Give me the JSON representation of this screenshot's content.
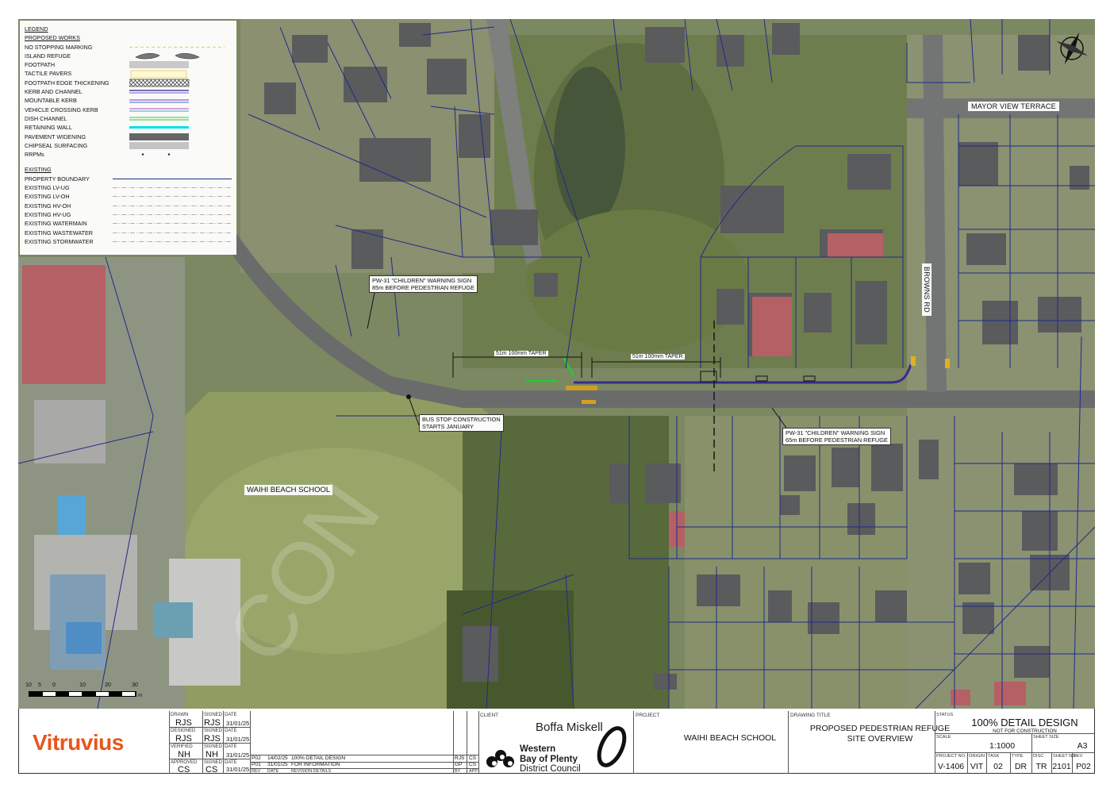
{
  "legend": {
    "heading": "LEGEND",
    "proposed_heading": "PROPOSED WORKS",
    "proposed": [
      {
        "label": "NO STOPPING MARKING",
        "symbol": "dash-yellow"
      },
      {
        "label": "ISLAND REFUGE",
        "symbol": "island"
      },
      {
        "label": "FOOTPATH",
        "symbol": "grey-fill"
      },
      {
        "label": "TACTILE PAVERS",
        "symbol": "tactile"
      },
      {
        "label": "FOOTPATH EDGE THICKENING",
        "symbol": "hatch"
      },
      {
        "label": "KERB AND CHANNEL",
        "symbol": "kerb"
      },
      {
        "label": "MOUNTABLE KERB",
        "symbol": "mountable"
      },
      {
        "label": "VEHICLE CROSSING KERB",
        "symbol": "vehicle"
      },
      {
        "label": "DISH CHANNEL",
        "symbol": "dish"
      },
      {
        "label": "RETAINING WALL",
        "symbol": "cyan"
      },
      {
        "label": "PAVEMENT WIDENING",
        "symbol": "dark-fill"
      },
      {
        "label": "CHIPSEAL SURFACING",
        "symbol": "light-fill"
      },
      {
        "label": "RRPMs",
        "symbol": "dots"
      }
    ],
    "existing_heading": "EXISTING",
    "existing": [
      {
        "label": "PROPERTY BOUNDARY",
        "symbol": "boundary"
      },
      {
        "label": "EXISTING LV-UG",
        "symbol": "service"
      },
      {
        "label": "EXISTING LV-OH",
        "symbol": "service"
      },
      {
        "label": "EXISTING HV-OH",
        "symbol": "service"
      },
      {
        "label": "EXISTING HV-UG",
        "symbol": "service"
      },
      {
        "label": "EXISTING WATERMAIN",
        "symbol": "service"
      },
      {
        "label": "EXISTING WASTEWATER",
        "symbol": "service"
      },
      {
        "label": "EXISTING STORMWATER",
        "symbol": "service"
      }
    ]
  },
  "annotations": {
    "sign_west": [
      "PW-31 \"CHILDREN\" WARNING SIGN",
      "85m BEFORE PEDESTRIAN REFUGE"
    ],
    "sign_east": [
      "PW-31 \"CHILDREN\" WARNING SIGN",
      "65m BEFORE PEDESTRIAN REFUGE"
    ],
    "bus_stop": [
      "BUS STOP CONSTRUCTION",
      "STARTS JANUARY"
    ],
    "taper_west": "51m 100mm TAPER",
    "taper_east": "51m 100mm TAPER"
  },
  "map_labels": {
    "mayor_view": "MAYOR VIEW TERRACE",
    "browns_rd": "BROWNS RD",
    "school": "WAIHI BEACH SCHOOL"
  },
  "scale_bar": {
    "ticks": [
      "10",
      "5",
      "0",
      "10",
      "20",
      "30"
    ],
    "unit": "m"
  },
  "title_block": {
    "company": "Vitruvius",
    "signatures": {
      "drawn_label": "DRAWN",
      "drawn": "RJS",
      "designed_label": "DESIGNED",
      "designed": "RJS",
      "verified_label": "VERIFIED",
      "verified": "NH",
      "approved_label": "APPROVED",
      "approved": "CS",
      "signed_label": "SIGNED",
      "signed": [
        "RJS",
        "RJS",
        "NH",
        "CS"
      ],
      "date_label": "DATE",
      "dates": [
        "31/01/25",
        "31/01/25",
        "31/01/25",
        "31/01/25"
      ]
    },
    "revisions": [
      {
        "rev": "P02",
        "date": "14/02/25",
        "details": "100% DETAIL DESIGN",
        "by": "RJS",
        "app": "CS"
      },
      {
        "rev": "P01",
        "date": "31/01/25",
        "details": "FOR INFORMATION",
        "by": "GP",
        "app": "CS"
      }
    ],
    "revision_headers": {
      "rev": "REV",
      "date": "DATE",
      "details": "REVISION DETAILS",
      "by": "BY",
      "app": "APP"
    },
    "client_label": "CLIENT",
    "client_primary": "Boffa Miskell",
    "client_secondary": [
      "Western",
      "Bay of Plenty",
      "District Council"
    ],
    "project_label": "PROJECT",
    "project": "WAIHI BEACH SCHOOL",
    "drawing_title_label": "DRAWING TITLE",
    "drawing_title": [
      "PROPOSED PEDESTRIAN REFUGE",
      "SITE OVERVIEW"
    ],
    "status_label": "STATUS",
    "status": "100% DETAIL DESIGN",
    "status_note": "NOT FOR CONSTRUCTION",
    "scale_label": "SCALE",
    "scale": "1:1000",
    "sheet_size_label": "SHEET SIZE",
    "sheet_size": "A3",
    "codes": [
      {
        "label": "PROJECT NO.",
        "value": "V-1406"
      },
      {
        "label": "ORIGIN",
        "value": "VIT"
      },
      {
        "label": "TASK",
        "value": "02"
      },
      {
        "label": "TYPE",
        "value": "DR"
      },
      {
        "label": "DISC",
        "value": "TR"
      },
      {
        "label": "SHEET NO.",
        "value": "2101"
      },
      {
        "label": "REV",
        "value": "P02"
      }
    ]
  }
}
